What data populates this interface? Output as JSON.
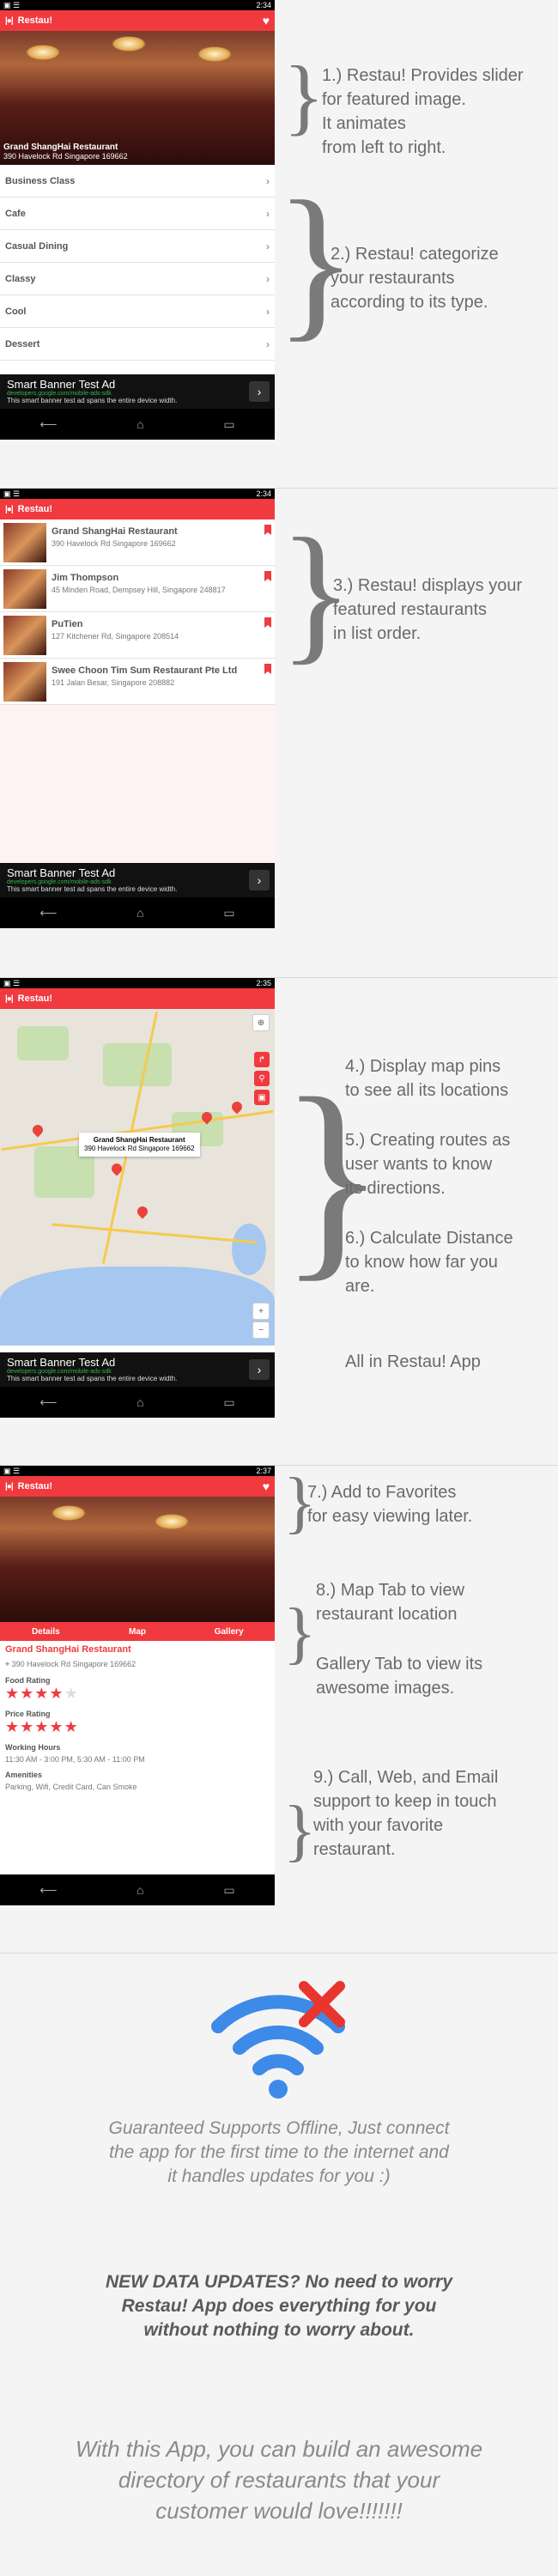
{
  "status_times": [
    "2:34",
    "2:34",
    "2:35",
    "2:37"
  ],
  "app": {
    "title": "Restau!",
    "logo": "|●|"
  },
  "screen1": {
    "hero_title": "Grand ShangHai Restaurant",
    "hero_address": "390 Havelock Rd Singapore 169662",
    "categories": [
      "Business Class",
      "Cafe",
      "Casual Dining",
      "Classy",
      "Cool",
      "Dessert"
    ]
  },
  "ad": {
    "title": "Smart Banner Test Ad",
    "url": "developers.google.com/mobile-ads-sdk",
    "desc": "This smart banner test ad spans the entire device width."
  },
  "screen2": {
    "restaurants": [
      {
        "name": "Grand ShangHai Restaurant",
        "address": "390 Havelock Rd Singapore 169662"
      },
      {
        "name": "Jim Thompson",
        "address": "45 Minden Road, Dempsey Hill, Singapore 248817"
      },
      {
        "name": "PuTien",
        "address": "127 Kitchener Rd, Singapore 208514"
      },
      {
        "name": "Swee Choon Tim Sum Restaurant Pte Ltd",
        "address": "191 Jalan Besar, Singapore 208882"
      }
    ]
  },
  "screen3": {
    "popup_title": "Grand ShangHai Restaurant",
    "popup_address": "390 Havelock Rd Singapore 169662"
  },
  "screen4": {
    "tabs": [
      "Details",
      "Map",
      "Gallery"
    ],
    "name": "Grand ShangHai Restaurant",
    "address": "390 Havelock Rd Singapore 169662",
    "food_rating_label": "Food Rating",
    "food_rating": 4,
    "price_rating_label": "Price Rating",
    "price_rating": 5,
    "hours_label": "Working Hours",
    "hours": "11:30 AM - 3:00 PM, 5:30 AM - 11:00 PM",
    "amenities_label": "Amenities",
    "amenities": "Parking, Wifi, Credit Card, Can Smoke"
  },
  "notes": {
    "n1": "1.) Restau! Provides slider\nfor featured image.\nIt animates\nfrom left to right.",
    "n2": "2.) Restau! categorize\n your restaurants\naccording to its type.",
    "n3": "3.) Restau! displays your\nfeatured restaurants\nin list order.",
    "n4": "4.) Display map pins\nto see all its locations",
    "n5": "5.) Creating routes as\nuser wants to know\nits directions.",
    "n6": "6.) Calculate Distance\nto know how far you\nare.",
    "n6b": "All in Restau! App",
    "n7": "7.) Add to Favorites\nfor easy viewing later.",
    "n8": "8.) Map Tab to view\nrestaurant location",
    "n8b": "Gallery Tab to view its\nawesome images.",
    "n9": "9.) Call, Web, and Email\nsupport to keep in touch\nwith your favorite\nrestaurant."
  },
  "closing": {
    "offline": "Guaranteed Supports Offline, Just connect\nthe app for the first time to the internet and\nit handles updates for you :)",
    "updates": "NEW DATA UPDATES? No need to worry\nRestau! App does everything for you\nwithout nothing to worry about.",
    "final": "With this App, you can build an awesome\ndirectory of restaurants that your\ncustomer would love!!!!!!!"
  },
  "colors": {
    "brand": "#f03a3f",
    "wifi": "#3d8ae8"
  }
}
